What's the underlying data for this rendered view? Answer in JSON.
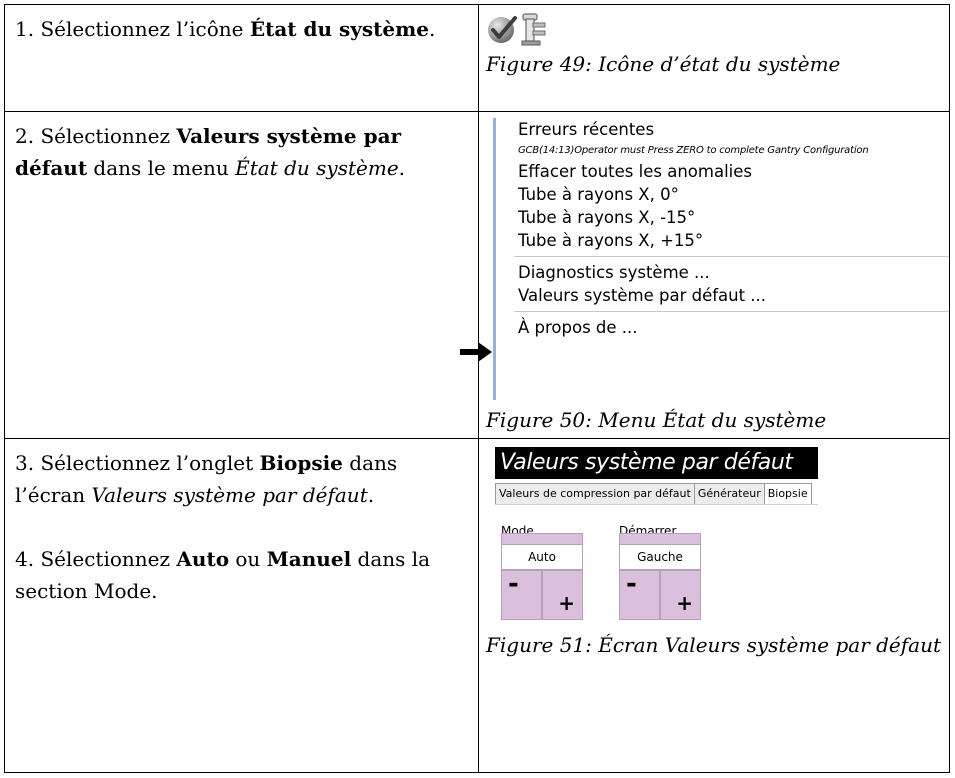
{
  "steps": [
    {
      "number": "1.",
      "before": " Sélectionnez l’icône ",
      "bold": "État du système",
      "after": "."
    },
    {
      "number": "2.",
      "before": " Sélectionnez ",
      "bold": "Valeurs système par défaut",
      "after_plain": " dans le menu ",
      "italic": "État du système",
      "end": "."
    },
    {
      "number": "3.",
      "before": " Sélectionnez l’onglet ",
      "bold": "Biopsie",
      "after_plain": " dans l’écran ",
      "italic": "Valeurs système par défaut",
      "end": "."
    },
    {
      "number": "4.",
      "before": " Sélectionnez ",
      "bold": "Auto",
      "mid": " ou ",
      "bold2": "Manuel",
      "after": " dans la section Mode."
    }
  ],
  "captions": {
    "fig49": "Figure 49: Icône d’état du système",
    "fig50": "Figure 50: Menu État du système",
    "fig51": "Figure 51: Écran Valeurs système par défaut"
  },
  "menu": {
    "items": [
      "Erreurs récentes",
      "GCB(14:13)Operator must Press ZERO to complete Gantry Configuration",
      "Effacer toutes les anomalies",
      "Tube à rayons X, 0°",
      "Tube à rayons X, -15°",
      "Tube à rayons X, +15°",
      "Diagnostics système ...",
      "Valeurs système par défaut ...",
      "À propos de ..."
    ]
  },
  "screen": {
    "title": "Valeurs système par défaut",
    "tabs": [
      "Valeurs de compression par défaut",
      "Générateur",
      "Biopsie"
    ],
    "active_tab": "Biopsie",
    "mode_label": "Mode",
    "start_label": "Démarrer",
    "mode_value": "Auto",
    "start_value": "Gauche",
    "minus": "-",
    "plus": "+"
  },
  "colors": {
    "menu_accent": "#8fb3d9",
    "spinner": "#dbc0dd",
    "titlebar": "#000000"
  },
  "icons": [
    "check-icon",
    "gantry-icon",
    "arrow-right-icon"
  ]
}
